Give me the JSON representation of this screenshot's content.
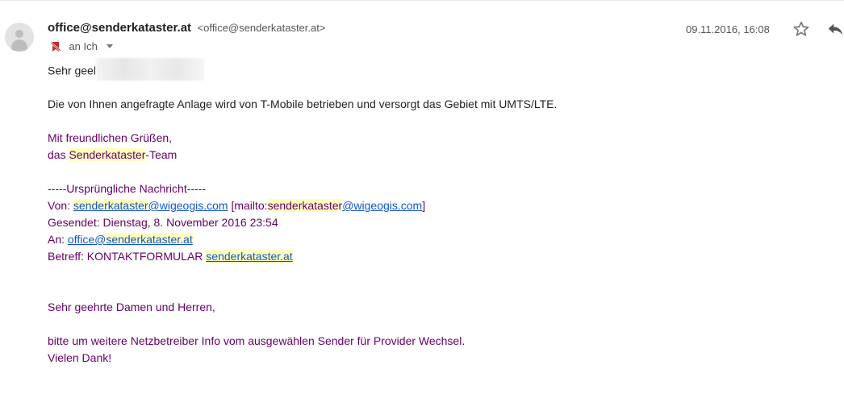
{
  "header": {
    "sender_name": "office@senderkataster.at",
    "sender_email": "<office@senderkataster.at>",
    "to_label": "an Ich",
    "date": "09.11.2016, 16:08"
  },
  "icons": {
    "star": "star-icon",
    "reply": "reply-icon",
    "avatar": "avatar-icon",
    "important": "important-marker-icon",
    "caret": "caret-down-icon"
  },
  "colors": {
    "quoted_text": "#660066",
    "link": "#1155cc",
    "highlight": "#ffffc0",
    "important_marker": "#c62828"
  },
  "body": {
    "greeting": "Sehr geel",
    "line1": "Die von Ihnen angefragte Anlage wird von T-Mobile betrieben und versorgt das Gebiet mit UMTS/LTE.",
    "closing1": "Mit freundlichen Grüßen,",
    "closing2_prefix": "das ",
    "closing2_hl": "Senderkataster",
    "closing2_suffix": "-Team",
    "orig_header": "-----Ursprüngliche Nachricht-----",
    "von_label": "Von: ",
    "von_link_hl": "senderkataster",
    "von_link_rest": "@wigeogis.com",
    "von_mailto_open": " [mailto:",
    "von_mailto_hl": "senderkataster",
    "von_mailto_rest": "@wigeogis.com",
    "von_mailto_close": "]",
    "gesendet": "Gesendet: Dienstag, 8. November 2016 23:54",
    "an_label": "An: ",
    "an_link_pre": "office@",
    "an_link_hl": "senderkataster.at",
    "betreff_label": "Betreff: KONTAKTFORMULAR ",
    "betreff_link_hl": "senderkataster.at",
    "orig_greeting": "Sehr geehrte Damen und Herren,",
    "orig_line1": "bitte um weitere Netzbetreiber Info vom ausgewählen Sender für Provider Wechsel.",
    "orig_line2": "Vielen Dank!"
  }
}
